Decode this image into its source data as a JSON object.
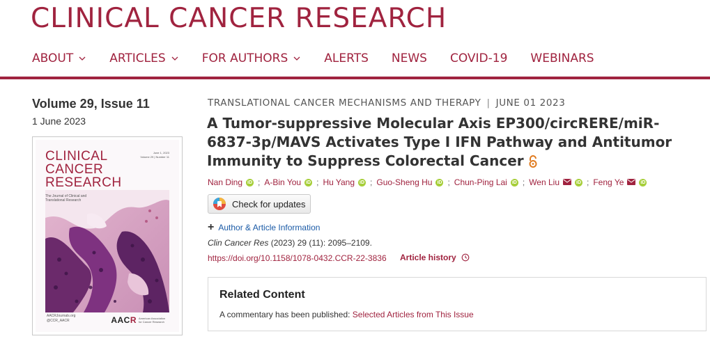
{
  "header": {
    "journal_title": "CLINICAL CANCER RESEARCH",
    "accent_color": "#a0233f"
  },
  "nav": {
    "items": [
      {
        "label": "ABOUT",
        "has_dropdown": true
      },
      {
        "label": "ARTICLES",
        "has_dropdown": true
      },
      {
        "label": "FOR AUTHORS",
        "has_dropdown": true
      },
      {
        "label": "ALERTS",
        "has_dropdown": false
      },
      {
        "label": "NEWS",
        "has_dropdown": false
      },
      {
        "label": "COVID-19",
        "has_dropdown": false
      },
      {
        "label": "WEBINARS",
        "has_dropdown": false
      }
    ]
  },
  "issue": {
    "volume_label": "Volume 29, Issue 11",
    "date": "1 June 2023",
    "cover": {
      "title_line1": "CLINICAL",
      "title_line2": "CANCER",
      "title_line3": "RESEARCH",
      "subtitle": "The Journal of Clinical and Translational Research",
      "meta_line1": "June 1, 2023",
      "meta_line2": "Volume 29 | Number 11",
      "footer_line1": "AACRJournals.org",
      "footer_line2": "@CCR_AACR",
      "logo_text_a": "AAC",
      "logo_text_r": "R",
      "logo_org": "American Association for Cancer Research"
    }
  },
  "article": {
    "section": "TRANSLATIONAL CANCER MECHANISMS AND THERAPY",
    "separator": "|",
    "pub_date": "JUNE 01 2023",
    "title": "A Tumor-suppressive Molecular Axis EP300/circRERE/miR-6837-3p/MAVS Activates Type I IFN Pathway and Antitumor Immunity to Suppress Colorectal Cancer",
    "open_access_icon": "open-lock-icon",
    "authors": [
      {
        "name": "Nan Ding",
        "orcid": true,
        "email": false
      },
      {
        "name": "A-Bin You",
        "orcid": true,
        "email": false
      },
      {
        "name": "Hu Yang",
        "orcid": true,
        "email": false
      },
      {
        "name": "Guo-Sheng Hu",
        "orcid": true,
        "email": false
      },
      {
        "name": "Chun-Ping Lai",
        "orcid": true,
        "email": false
      },
      {
        "name": "Wen Liu",
        "orcid": true,
        "email": true
      },
      {
        "name": "Feng Ye",
        "orcid": true,
        "email": true
      }
    ],
    "author_separator": ";",
    "check_updates_label": "Check for updates",
    "author_info_label": "Author & Article Information",
    "citation_journal": "Clin Cancer Res",
    "citation_rest": " (2023) 29 (11): 2095–2109.",
    "doi": "https://doi.org/10.1158/1078-0432.CCR-22-3836",
    "history_label": "Article history"
  },
  "related": {
    "title": "Related Content",
    "text": "A commentary has been published: ",
    "link": "Selected Articles from This Issue"
  }
}
